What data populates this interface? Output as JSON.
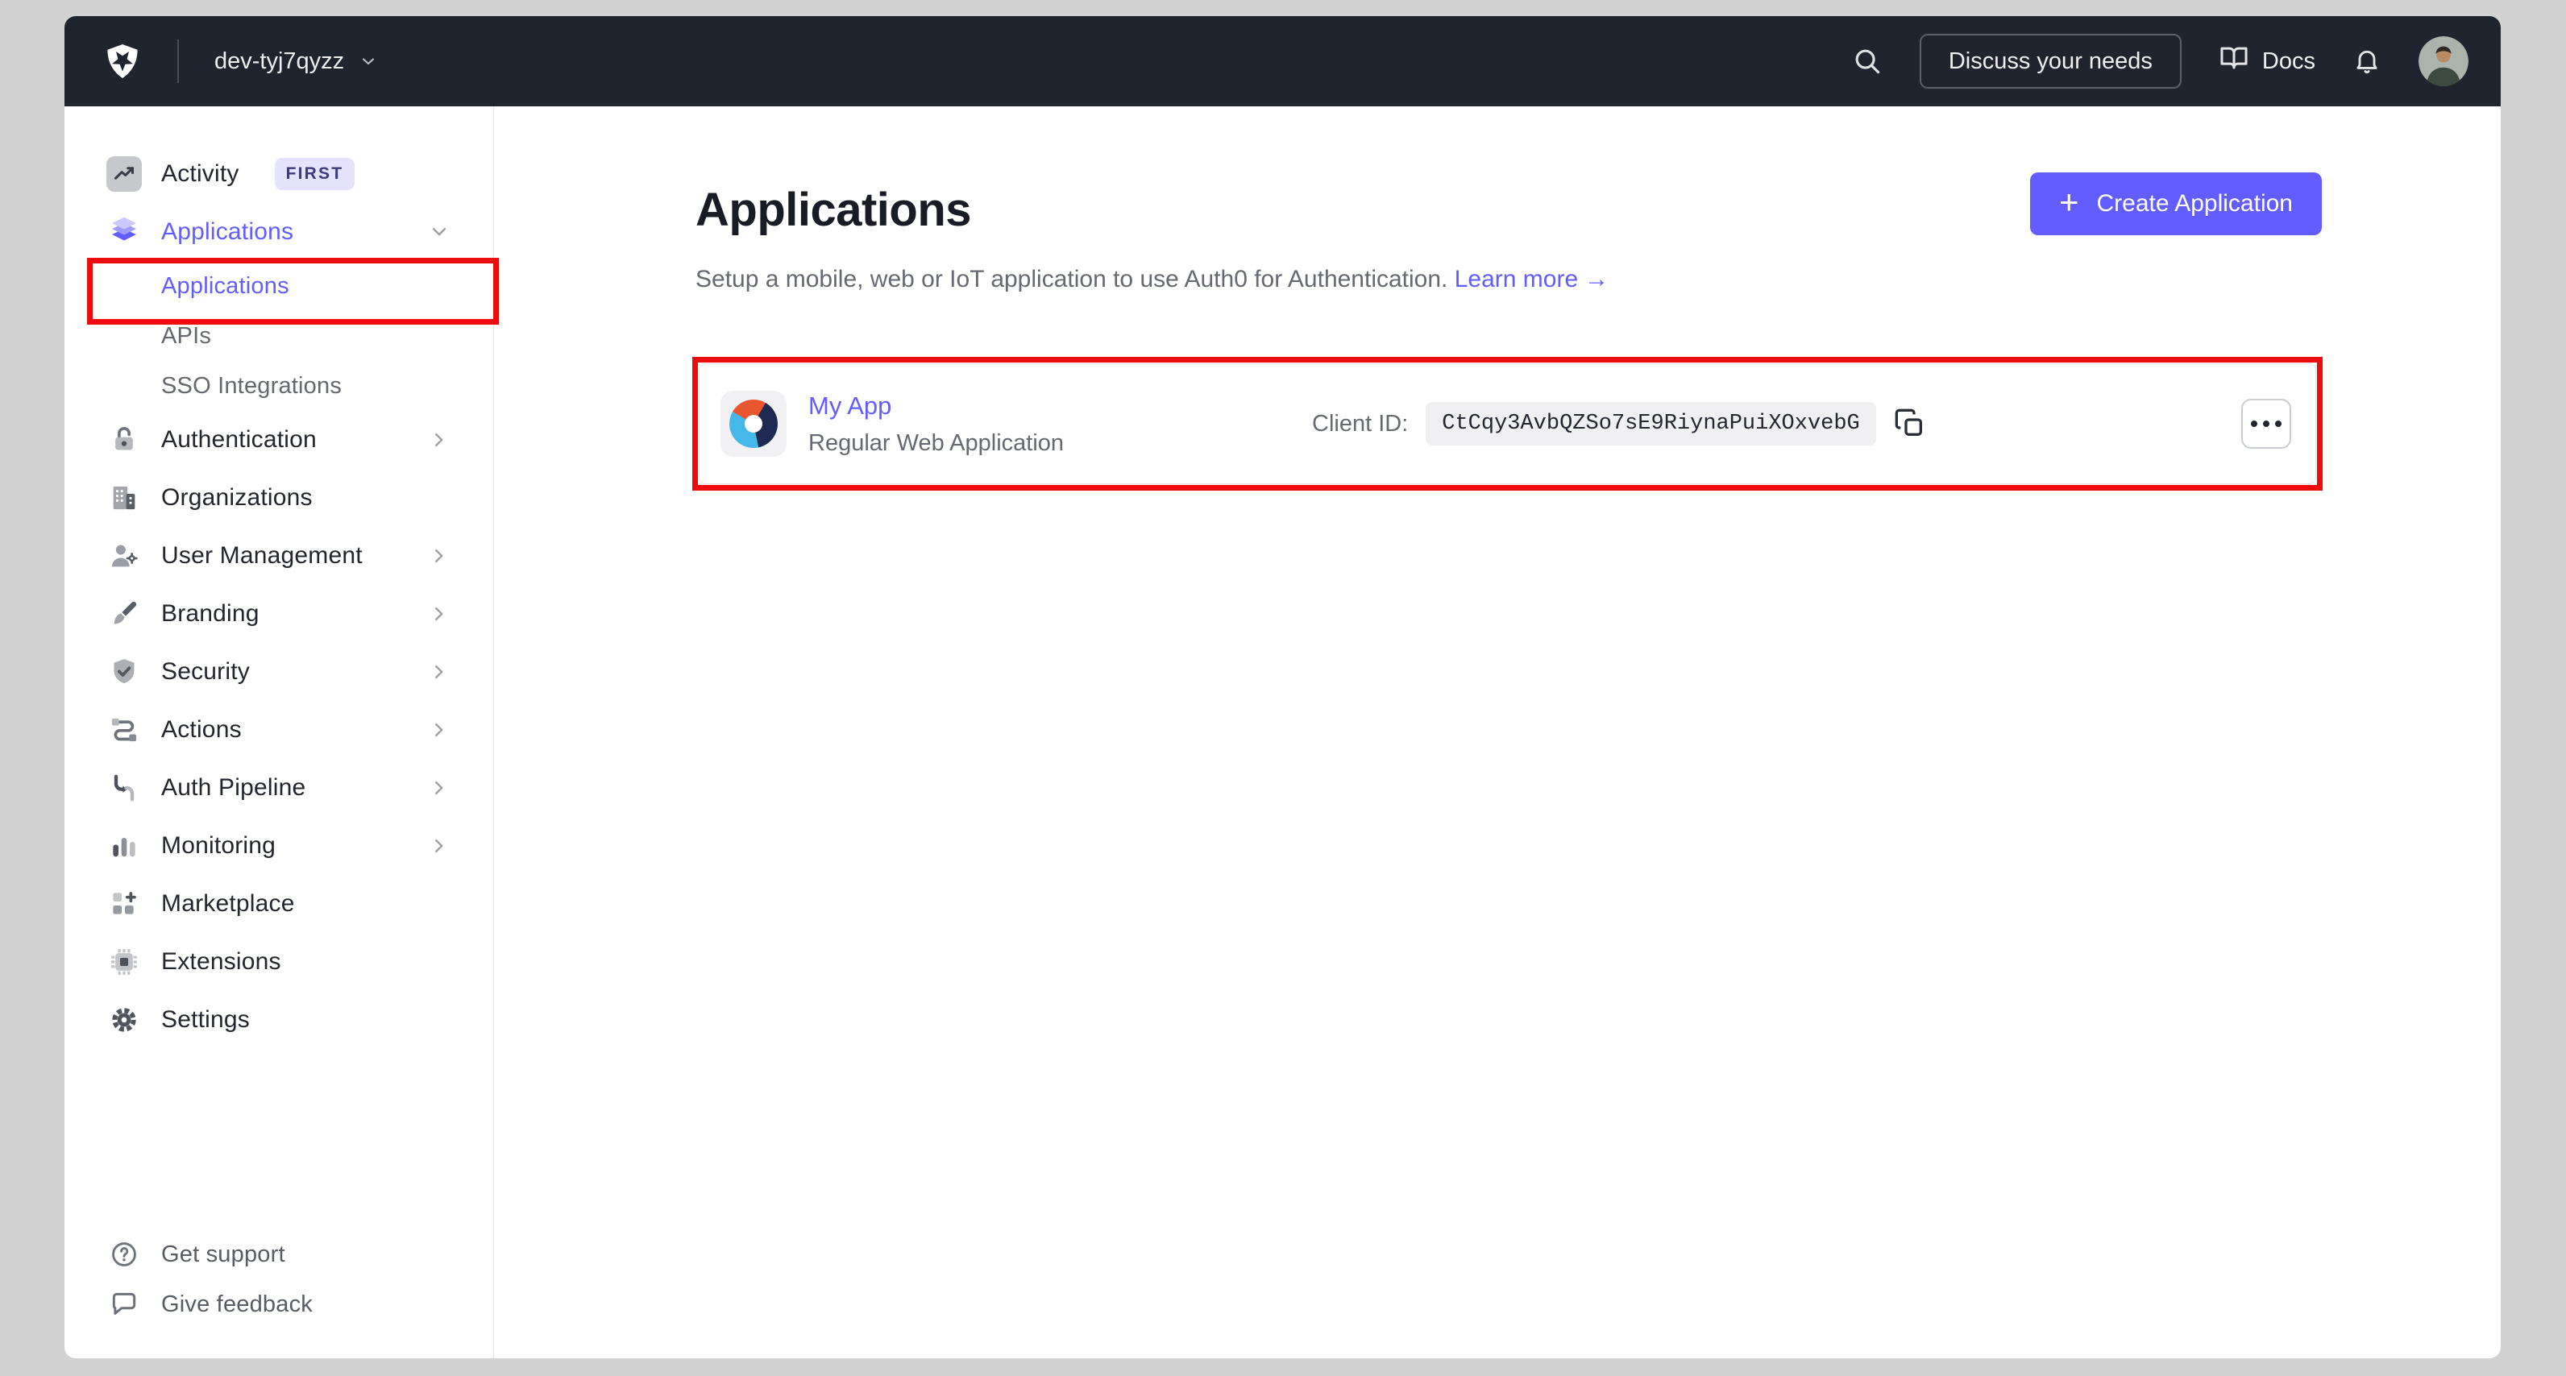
{
  "topbar": {
    "tenant": "dev-tyj7qyzz",
    "discuss_button": "Discuss your needs",
    "docs_label": "Docs"
  },
  "icons": {
    "plus": "+",
    "logo": "auth0-shield-star",
    "search": "magnifier",
    "docs": "open-book",
    "notifications": "bell",
    "copy": "duplicate-squares",
    "more": "ellipsis"
  },
  "sidebar": {
    "items": [
      {
        "label": "Activity",
        "badge": "FIRST",
        "icon": "activity-chart-icon",
        "has_submenu": false
      },
      {
        "label": "Applications",
        "icon": "layers-icon",
        "expanded": true,
        "active": true
      },
      {
        "label": "Applications",
        "child": true,
        "active": true
      },
      {
        "label": "APIs",
        "child": true
      },
      {
        "label": "SSO Integrations",
        "child": true
      },
      {
        "label": "Authentication",
        "icon": "lock-icon",
        "has_submenu": true
      },
      {
        "label": "Organizations",
        "icon": "building-icon",
        "has_submenu": false
      },
      {
        "label": "User Management",
        "icon": "user-gear-icon",
        "has_submenu": true
      },
      {
        "label": "Branding",
        "icon": "paintbrush-icon",
        "has_submenu": true
      },
      {
        "label": "Security",
        "icon": "shield-check-icon",
        "has_submenu": true
      },
      {
        "label": "Actions",
        "icon": "flow-icon",
        "has_submenu": true
      },
      {
        "label": "Auth Pipeline",
        "icon": "pipeline-icon",
        "has_submenu": true
      },
      {
        "label": "Monitoring",
        "icon": "bar-chart-icon",
        "has_submenu": true
      },
      {
        "label": "Marketplace",
        "icon": "grid-plus-icon",
        "has_submenu": false
      },
      {
        "label": "Extensions",
        "icon": "chip-icon",
        "has_submenu": false
      },
      {
        "label": "Settings",
        "icon": "gear-icon",
        "has_submenu": false
      }
    ],
    "footer": [
      {
        "label": "Get support",
        "icon": "help-circle-icon"
      },
      {
        "label": "Give feedback",
        "icon": "speech-bubble-icon"
      }
    ]
  },
  "main": {
    "title": "Applications",
    "subtitle": "Setup a mobile, web or IoT application to use Auth0 for Authentication.",
    "learn_more": "Learn more",
    "learn_more_arrow": "→",
    "create_button": "Create Application",
    "app_row": {
      "name": "My App",
      "type": "Regular Web Application",
      "client_id_label": "Client ID:",
      "client_id": "CtCqy3AvbQZSo7sE9RiynaPuiXOxvebG"
    }
  },
  "annotations": {
    "color": "#ee0b0b",
    "boxes": [
      "sidebar-applications-item",
      "application-row"
    ]
  },
  "colors": {
    "accent": "#635dff",
    "topbar_bg": "#20242e",
    "frame_bg": "#d2d2d2",
    "badge_bg": "#e5e3ff",
    "badge_text": "#3e3a7e",
    "chip_bg": "#f0f0f2"
  }
}
